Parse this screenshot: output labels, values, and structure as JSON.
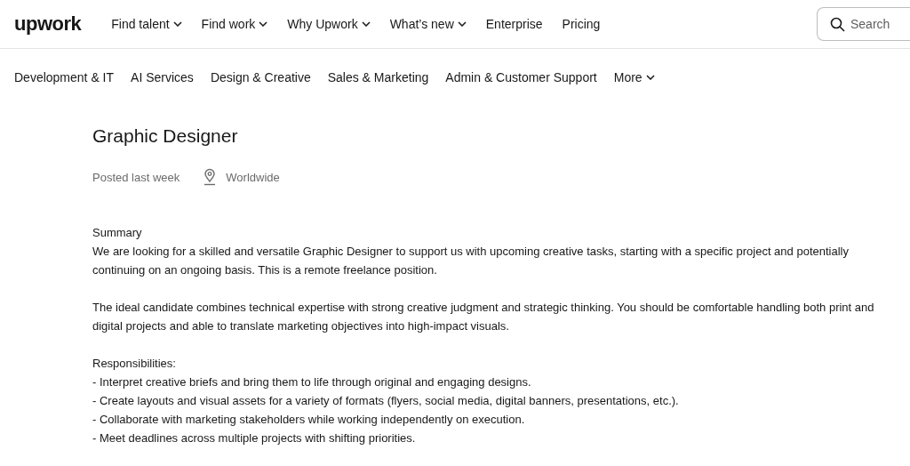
{
  "header": {
    "logo": "upwork",
    "nav": [
      {
        "label": "Find talent",
        "has_menu": true
      },
      {
        "label": "Find work",
        "has_menu": true
      },
      {
        "label": "Why Upwork",
        "has_menu": true
      },
      {
        "label": "What’s new",
        "has_menu": true
      },
      {
        "label": "Enterprise",
        "has_menu": false
      },
      {
        "label": "Pricing",
        "has_menu": false
      }
    ],
    "search": {
      "placeholder": "Search"
    }
  },
  "categories": [
    {
      "label": "Development & IT",
      "has_menu": false
    },
    {
      "label": "AI Services",
      "has_menu": false
    },
    {
      "label": "Design & Creative",
      "has_menu": false
    },
    {
      "label": "Sales & Marketing",
      "has_menu": false
    },
    {
      "label": "Admin & Customer Support",
      "has_menu": false
    },
    {
      "label": "More",
      "has_menu": true
    }
  ],
  "job": {
    "title": "Graphic Designer",
    "posted": "Posted last week",
    "location": "Worldwide",
    "sections": [
      {
        "heading": "Summary",
        "lines": [
          "We are looking for a skilled and versatile Graphic Designer to support us with upcoming creative tasks, starting with a specific project and potentially continuing on an ongoing basis. This is a remote freelance position."
        ]
      },
      {
        "lines": [
          "The ideal candidate combines technical expertise with strong creative judgment and strategic thinking. You should be comfortable handling both print and digital projects and able to translate marketing objectives into high-impact visuals."
        ]
      },
      {
        "heading": "Responsibilities:",
        "lines": [
          "- Interpret creative briefs and bring them to life through original and engaging designs.",
          "- Create layouts and visual assets for a variety of formats (flyers, social media, digital banners, presentations, etc.).",
          "- Collaborate with marketing stakeholders while working independently on execution.",
          "- Meet deadlines across multiple projects with shifting priorities."
        ]
      }
    ]
  }
}
